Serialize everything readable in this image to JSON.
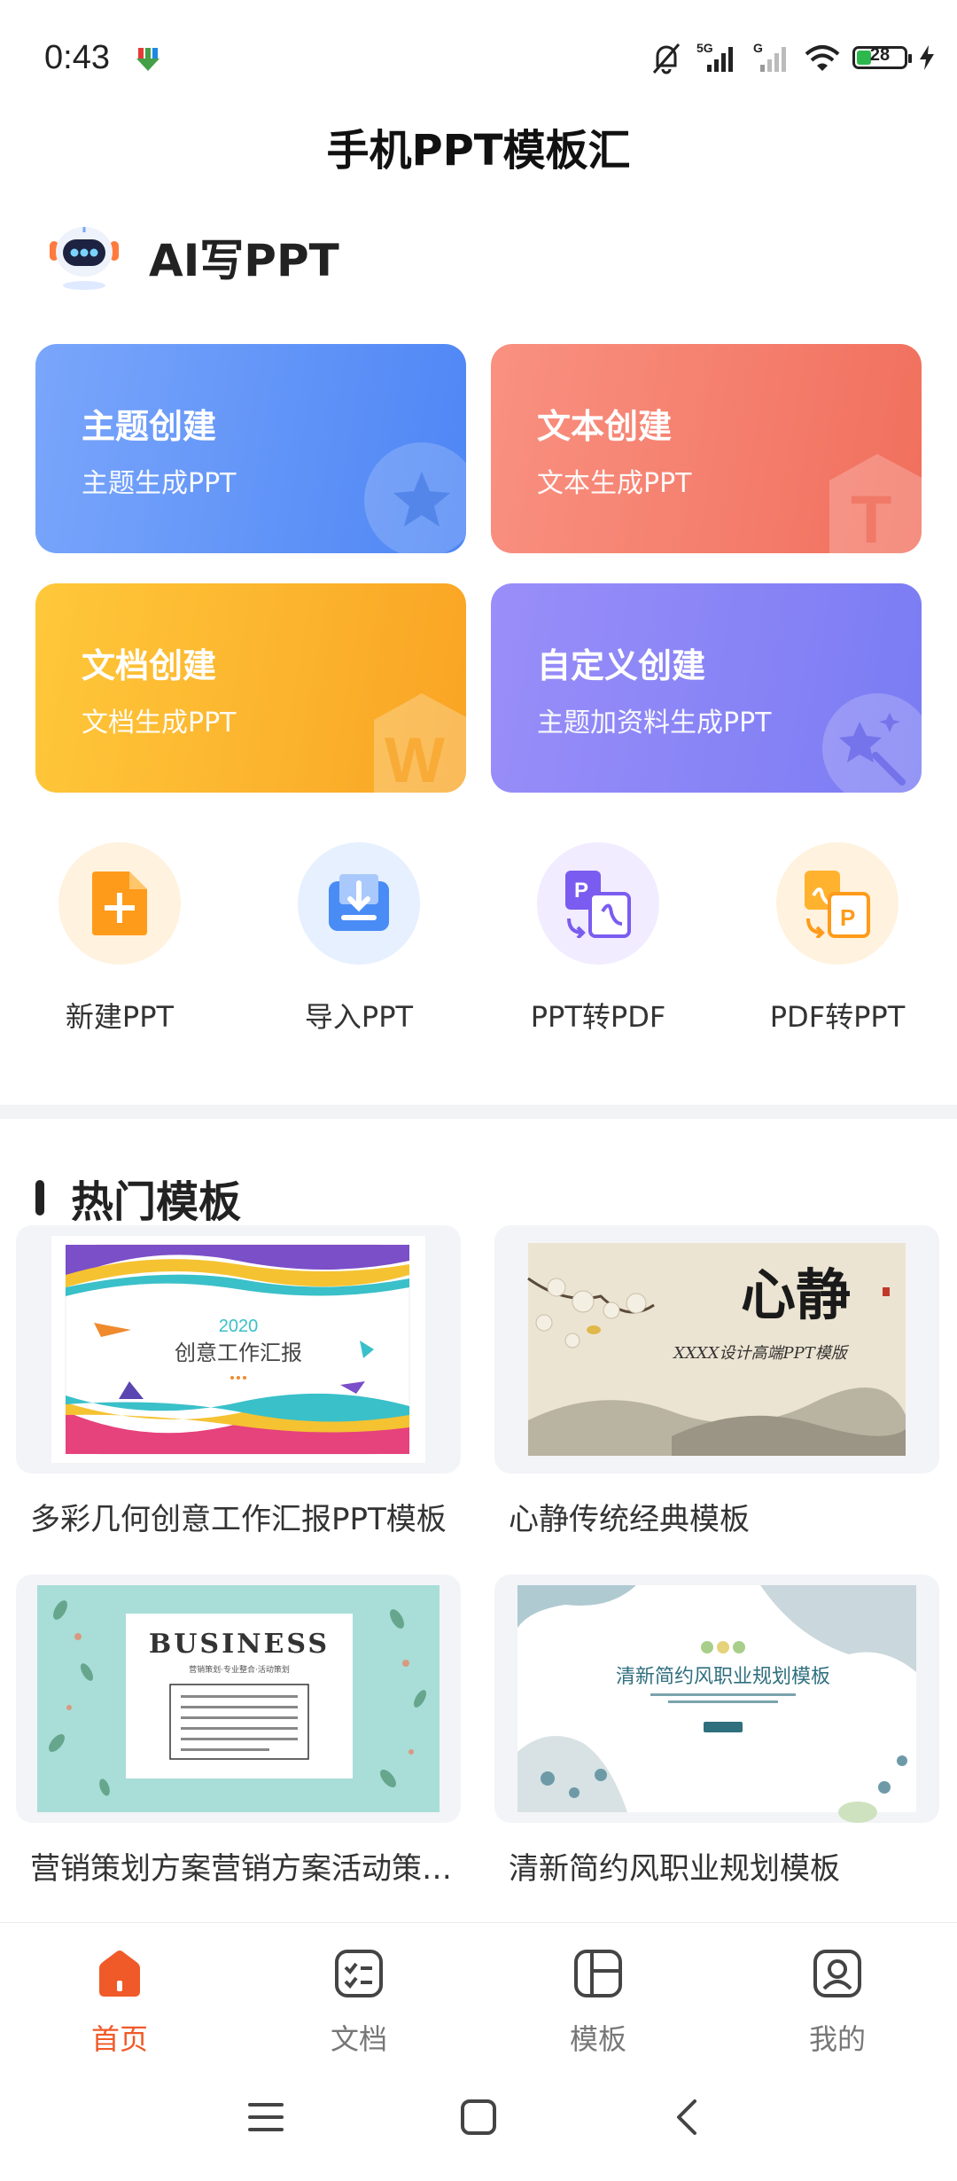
{
  "status_bar": {
    "time": "0:43",
    "network": "5G",
    "battery": "28"
  },
  "app_title": "手机PPT模板汇",
  "ai_section": {
    "label": "AI写PPT"
  },
  "create_cards": [
    {
      "title": "主题创建",
      "subtitle": "主题生成PPT",
      "icon": "star-icon"
    },
    {
      "title": "文本创建",
      "subtitle": "文本生成PPT",
      "icon": "text-t-icon"
    },
    {
      "title": "文档创建",
      "subtitle": "文档生成PPT",
      "icon": "word-w-icon"
    },
    {
      "title": "自定义创建",
      "subtitle": "主题加资料生成PPT",
      "icon": "magic-wand-icon"
    }
  ],
  "tools": [
    {
      "label": "新建PPT",
      "icon": "new-file-icon"
    },
    {
      "label": "导入PPT",
      "icon": "import-icon"
    },
    {
      "label": "PPT转PDF",
      "icon": "ppt-to-pdf-icon"
    },
    {
      "label": "PDF转PPT",
      "icon": "pdf-to-ppt-icon"
    }
  ],
  "hot_templates": {
    "title": "热门模板",
    "items": [
      {
        "name": "多彩几何创意工作汇报PPT模板",
        "thumb_year": "2020",
        "thumb_title": "创意工作汇报"
      },
      {
        "name": "心静传统经典模板",
        "thumb_title": "心静",
        "thumb_sub": "XXXX设计高端PPT模版"
      },
      {
        "name": "营销策划方案营销方案活动策划PPT",
        "thumb_title": "BUSINESS",
        "thumb_sub": "营销策划·专业整合·活动策划"
      },
      {
        "name": "清新简约风职业规划模板",
        "thumb_title": "清新简约风职业规划模板"
      }
    ]
  },
  "tabbar": [
    {
      "label": "首页",
      "active": true
    },
    {
      "label": "文档",
      "active": false
    },
    {
      "label": "模板",
      "active": false
    },
    {
      "label": "我的",
      "active": false
    }
  ],
  "colors": {
    "accent": "#f05a28",
    "blue_card": "#5b8ef6",
    "red_card": "#f47a69",
    "yellow_card": "#fbb42e",
    "purple_card": "#8684f5"
  }
}
